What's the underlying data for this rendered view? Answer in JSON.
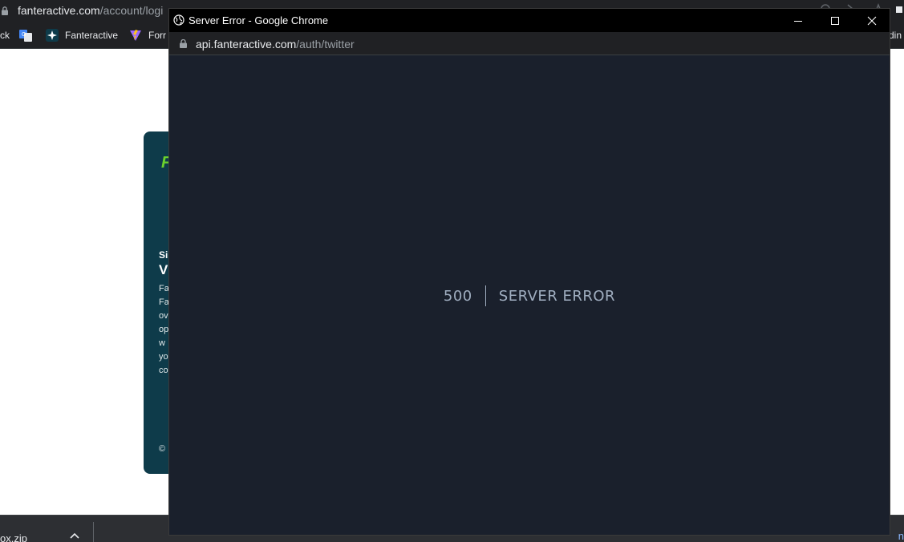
{
  "background_browser": {
    "url_host": "fanteractive.com",
    "url_path": "/account/logi",
    "bookmarks": [
      {
        "label": "ck"
      },
      {
        "label": "Fanteractive",
        "icon": "fanteractive-star-icon"
      },
      {
        "label": "Forr",
        "icon": "vite-logo-icon"
      }
    ],
    "bookmark_right_fragment": "din",
    "card": {
      "logo_fragment": "F",
      "heading_small": "Si",
      "heading_large": "V",
      "paragraph_fragments": [
        "Fa",
        "Fa",
        "ov",
        "op",
        "w",
        "yo",
        "co"
      ],
      "footer": "©"
    },
    "downloads": {
      "file_name": "ox.zip",
      "right_fragment": "n"
    }
  },
  "popup": {
    "window_title": "Server Error - Google Chrome",
    "url_host": "api.fanteractive.com",
    "url_path": "/auth/twitter",
    "error_code": "500",
    "error_message": "SERVER ERROR",
    "colors": {
      "page_background": "#1a202c",
      "error_text": "#a0aec0",
      "titlebar": "#000000"
    }
  }
}
